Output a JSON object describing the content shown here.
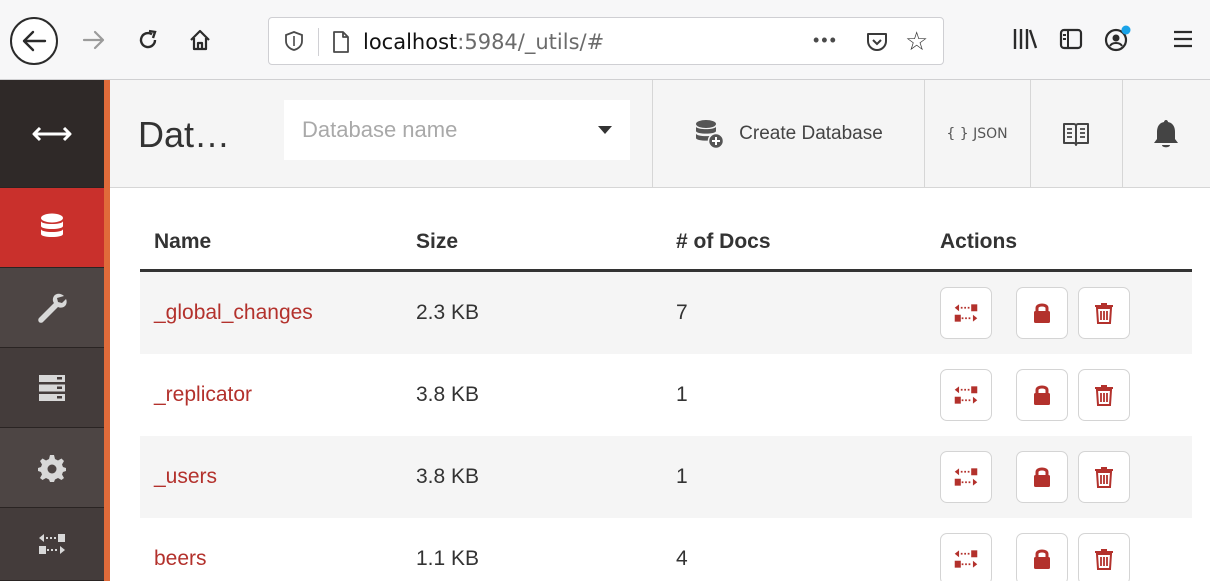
{
  "browser": {
    "url_host": "localhost",
    "url_path": ":5984/_utils/#",
    "more_label": "•••"
  },
  "header": {
    "title": "Dat…",
    "db_search_placeholder": "Database name",
    "create_database_label": "Create Database",
    "json_label": "{ } JSON"
  },
  "table": {
    "columns": [
      "Name",
      "Size",
      "# of Docs",
      "Actions"
    ],
    "rows": [
      {
        "name": "_global_changes",
        "size": "2.3 KB",
        "docs": "7"
      },
      {
        "name": "_replicator",
        "size": "3.8 KB",
        "docs": "1"
      },
      {
        "name": "_users",
        "size": "3.8 KB",
        "docs": "1"
      },
      {
        "name": "beers",
        "size": "1.1 KB",
        "docs": "4"
      }
    ]
  },
  "colors": {
    "accent_red": "#c9302c",
    "link_red": "#b3312c",
    "nav_dark": "#3b3433",
    "nav_border_orange": "#e06b3a"
  },
  "icons": [
    "back-arrow-icon",
    "forward-arrow-icon",
    "reload-icon",
    "home-icon",
    "shield-icon",
    "page-icon",
    "pocket-icon",
    "star-icon",
    "library-icon",
    "sidebar-icon",
    "account-icon",
    "hamburger-menu-icon",
    "expand-arrows-icon",
    "database-icon",
    "wrench-icon",
    "server-icon",
    "gear-icon",
    "replication-icon",
    "create-database-icon",
    "book-icon",
    "bell-icon",
    "lock-icon",
    "trash-icon"
  ]
}
